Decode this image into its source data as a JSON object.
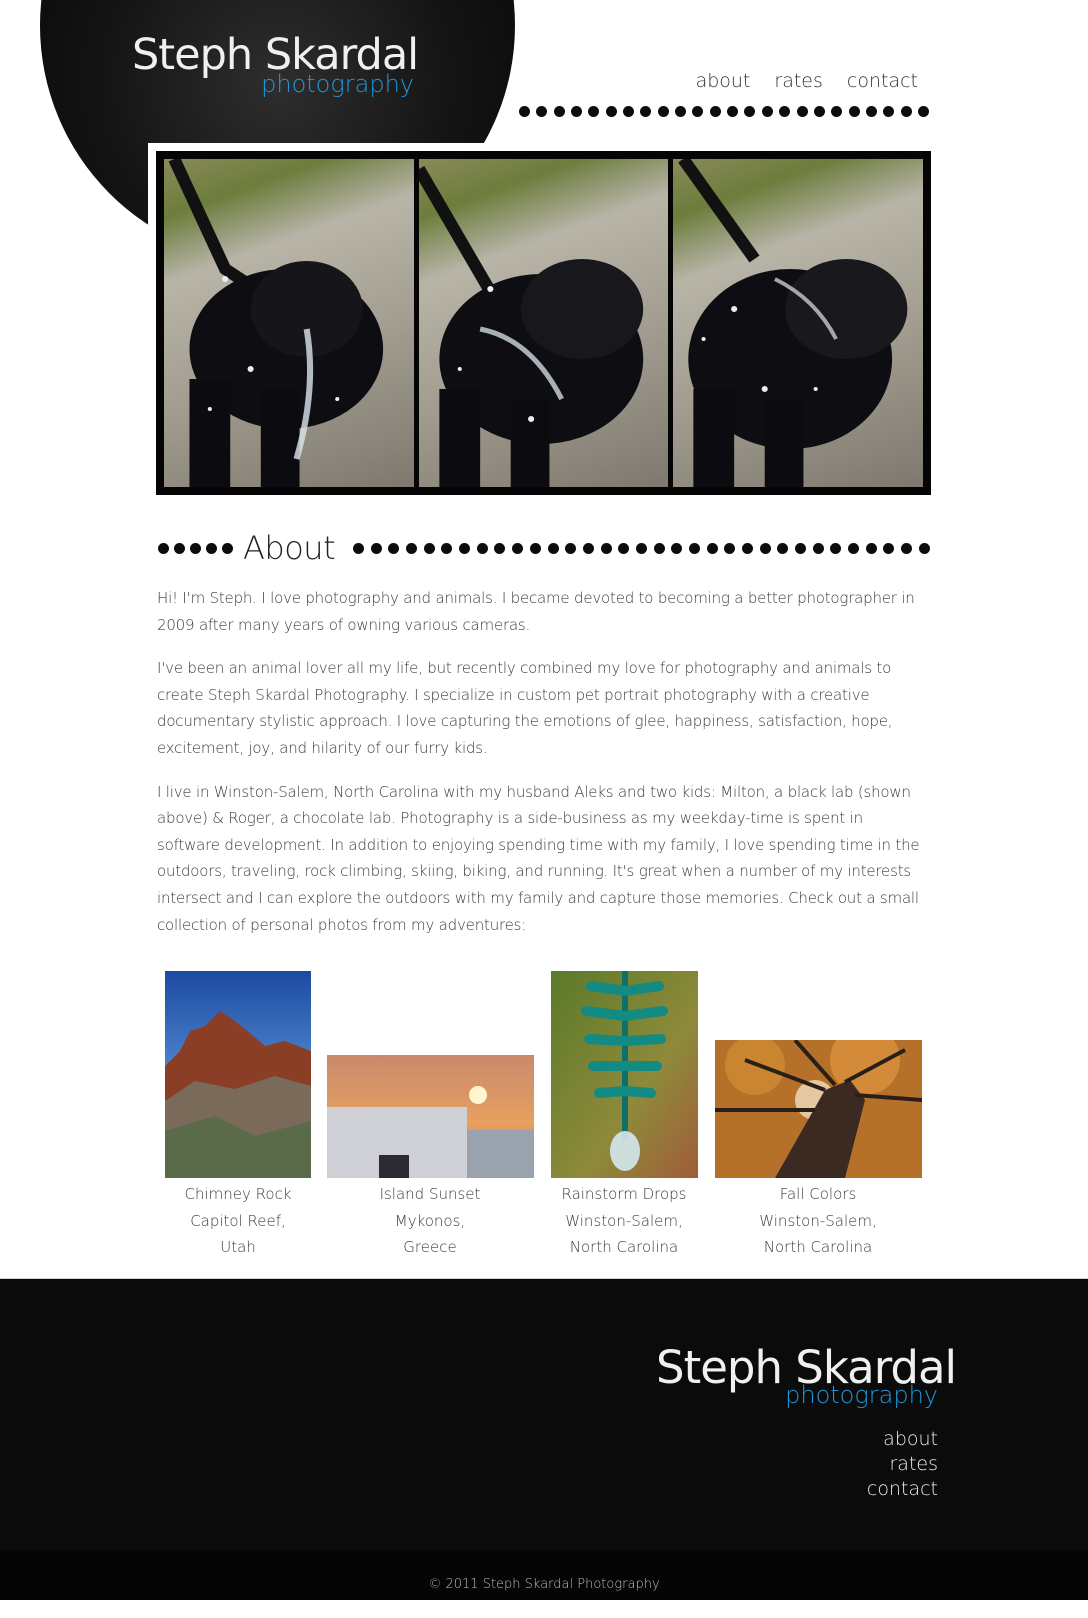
{
  "brand": {
    "name": "Steph Skardal",
    "tagline": "photography"
  },
  "nav": {
    "items": [
      "about",
      "rates",
      "contact"
    ]
  },
  "section": {
    "title": "About"
  },
  "about": {
    "paragraphs": [
      "Hi! I'm Steph. I love photography and animals. I became devoted to becoming a better photographer in 2009 after many years of owning various cameras.",
      "I've been an animal lover all my life, but recently combined my love for photography and animals to create Steph Skardal Photography. I specialize in custom pet portrait photography with a creative documentary stylistic approach. I love capturing the emotions of glee, happiness, satisfaction, hope, excitement, joy, and hilarity of our furry kids.",
      "I live in Winston-Salem, North Carolina with my husband Aleks and two kids: Milton, a black lab (shown above) & Roger, a chocolate lab. Photography is a side-business as my weekday-time is spent in software development. In addition to enjoying spending time with my family, I love spending time in the outdoors, traveling, rock climbing, skiing, biking, and running. It's great when a number of my interests intersect and I can explore the outdoors with my family and capture those memories. Check out a small collection of personal photos from my adventures:"
    ]
  },
  "gallery": [
    {
      "title": "Chimney Rock",
      "line2": "Capitol Reef,",
      "line3": "Utah"
    },
    {
      "title": "Island Sunset",
      "line2": "Mykonos,",
      "line3": "Greece"
    },
    {
      "title": "Rainstorm Drops",
      "line2": "Winston-Salem,",
      "line3": "North Carolina"
    },
    {
      "title": "Fall Colors",
      "line2": "Winston-Salem,",
      "line3": "North Carolina"
    }
  ],
  "footer": {
    "nav": [
      "about",
      "rates",
      "contact"
    ],
    "copyright": "© 2011 Steph Skardal Photography"
  },
  "colors": {
    "accent": "#2196d9",
    "dark": "#0b0b0b"
  }
}
